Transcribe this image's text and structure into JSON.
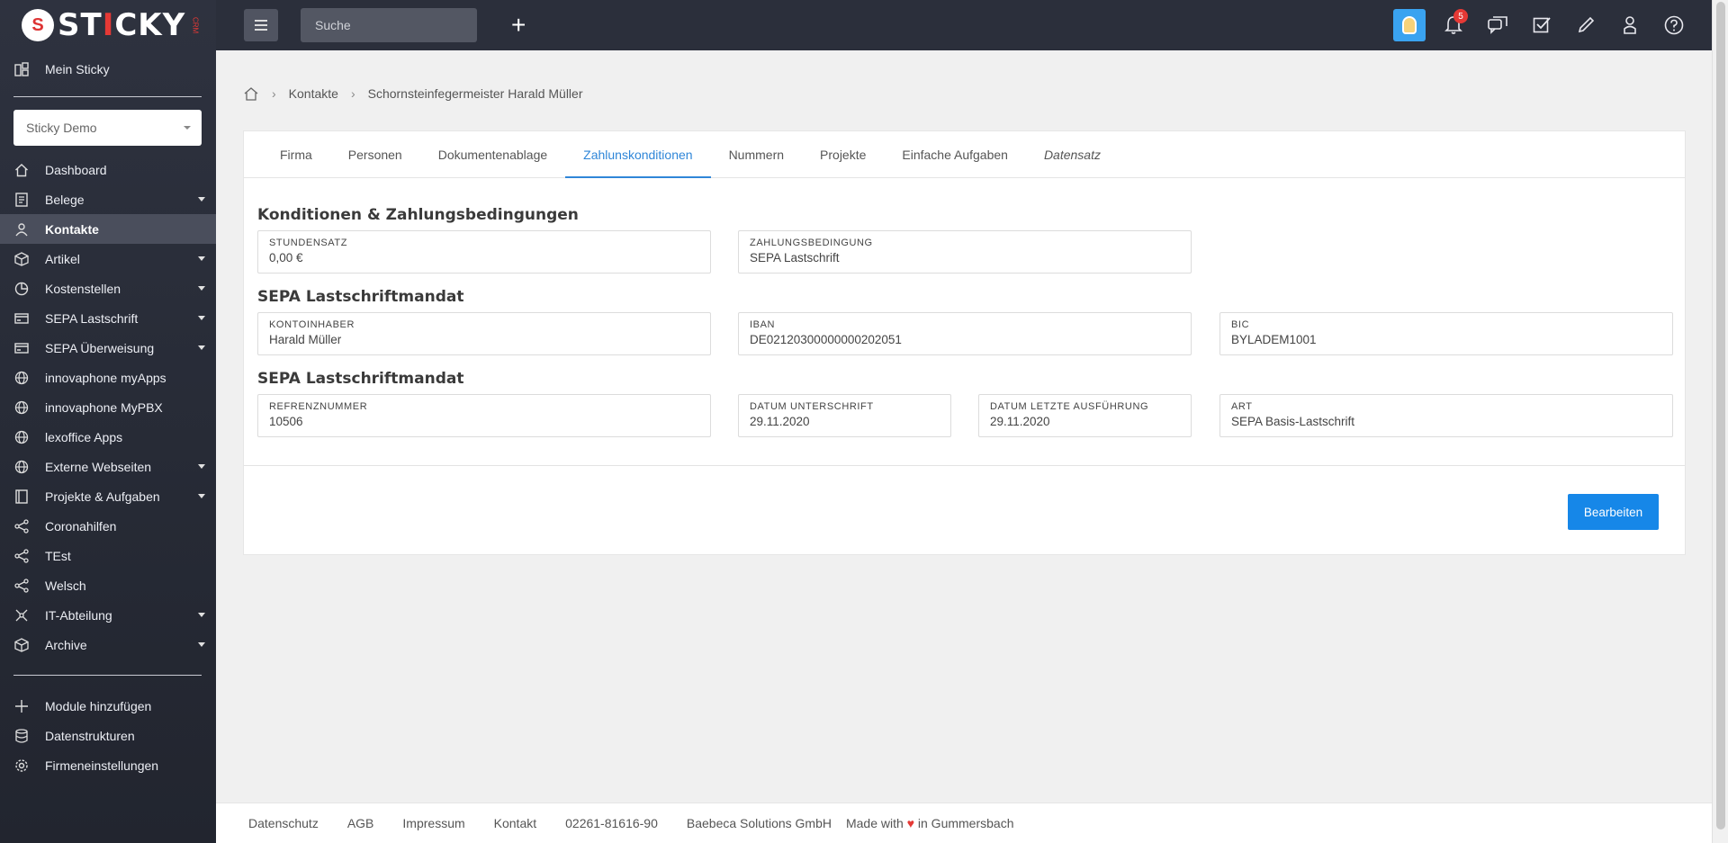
{
  "brand": {
    "name_prefix": "ST",
    "name_i": "I",
    "name_suffix": "CKY",
    "tag": "CRM"
  },
  "sidebar": {
    "top_item": {
      "label": "Mein Sticky",
      "icon": "dashboard-grid-icon"
    },
    "tenant_select": {
      "value": "Sticky Demo"
    },
    "items": [
      {
        "label": "Dashboard",
        "icon": "home-icon",
        "expandable": false,
        "active": false
      },
      {
        "label": "Belege",
        "icon": "document-icon",
        "expandable": true,
        "active": false
      },
      {
        "label": "Kontakte",
        "icon": "contacts-icon",
        "expandable": false,
        "active": true
      },
      {
        "label": "Artikel",
        "icon": "box-icon",
        "expandable": true,
        "active": false
      },
      {
        "label": "Kostenstellen",
        "icon": "pie-chart-icon",
        "expandable": true,
        "active": false
      },
      {
        "label": "SEPA Lastschrift",
        "icon": "card-icon",
        "expandable": true,
        "active": false
      },
      {
        "label": "SEPA Überweisung",
        "icon": "card-icon",
        "expandable": true,
        "active": false
      },
      {
        "label": "innovaphone myApps",
        "icon": "globe-icon",
        "expandable": false,
        "active": false
      },
      {
        "label": "innovaphone MyPBX",
        "icon": "globe-icon",
        "expandable": false,
        "active": false
      },
      {
        "label": "lexoffice Apps",
        "icon": "globe-icon",
        "expandable": false,
        "active": false
      },
      {
        "label": "Externe Webseiten",
        "icon": "globe-icon",
        "expandable": true,
        "active": false
      },
      {
        "label": "Projekte & Aufgaben",
        "icon": "book-icon",
        "expandable": true,
        "active": false
      },
      {
        "label": "Coronahilfen",
        "icon": "share-icon",
        "expandable": false,
        "active": false
      },
      {
        "label": "TEst",
        "icon": "share-icon",
        "expandable": false,
        "active": false
      },
      {
        "label": "Welsch",
        "icon": "share-icon",
        "expandable": false,
        "active": false
      },
      {
        "label": "IT-Abteilung",
        "icon": "network-icon",
        "expandable": true,
        "active": false
      },
      {
        "label": "Archive",
        "icon": "box-icon",
        "expandable": true,
        "active": false
      }
    ],
    "bottom_items": [
      {
        "label": "Module hinzufügen",
        "icon": "plus-icon"
      },
      {
        "label": "Datenstrukturen",
        "icon": "database-icon"
      },
      {
        "label": "Firmeneinstellungen",
        "icon": "gear-icon"
      }
    ]
  },
  "topbar": {
    "search_placeholder": "Suche",
    "notification_count": "5"
  },
  "breadcrumb": [
    "Kontakte",
    "Schornsteinfegermeister Harald Müller"
  ],
  "tabs": [
    "Firma",
    "Personen",
    "Dokumentenablage",
    "Zahlunskonditionen",
    "Nummern",
    "Projekte",
    "Einfache Aufgaben",
    "Datensatz"
  ],
  "active_tab": "Zahlunskonditionen",
  "sections": {
    "konditionen": {
      "title": "Konditionen & Zahlungsbedingungen",
      "stundensatz": {
        "label": "STUNDENSATZ",
        "value": "0,00 €"
      },
      "zahlungsbedingung": {
        "label": "ZAHLUNGSBEDINGUNG",
        "value": "SEPA Lastschrift"
      }
    },
    "mandat1": {
      "title": "SEPA Lastschriftmandat",
      "kontoinhaber": {
        "label": "KONTOINHABER",
        "value": "Harald Müller"
      },
      "iban": {
        "label": "IBAN",
        "value": "DE02120300000000202051"
      },
      "bic": {
        "label": "BIC",
        "value": "BYLADEM1001"
      }
    },
    "mandat2": {
      "title": "SEPA Lastschriftmandat",
      "referenz": {
        "label": "REFRENZNUMMER",
        "value": "10506"
      },
      "datum_unterschrift": {
        "label": "DATUM UNTERSCHRIFT",
        "value": "29.11.2020"
      },
      "datum_letzte": {
        "label": "DATUM LETZTE AUSFÜHRUNG",
        "value": "29.11.2020"
      },
      "art": {
        "label": "ART",
        "value": "SEPA Basis-Lastschrift"
      }
    }
  },
  "edit_button": "Bearbeiten",
  "footer": {
    "links": [
      "Datenschutz",
      "AGB",
      "Impressum",
      "Kontakt"
    ],
    "phone": "02261-81616-90",
    "company": "Baebeca Solutions GmbH",
    "made_prefix": "Made with",
    "made_suffix": "in Gummersbach"
  },
  "colors": {
    "accent": "#1687e8",
    "sidebar_bg": "#2e323f",
    "topbar_bg": "#2b2f3b",
    "badge": "#e53935"
  }
}
